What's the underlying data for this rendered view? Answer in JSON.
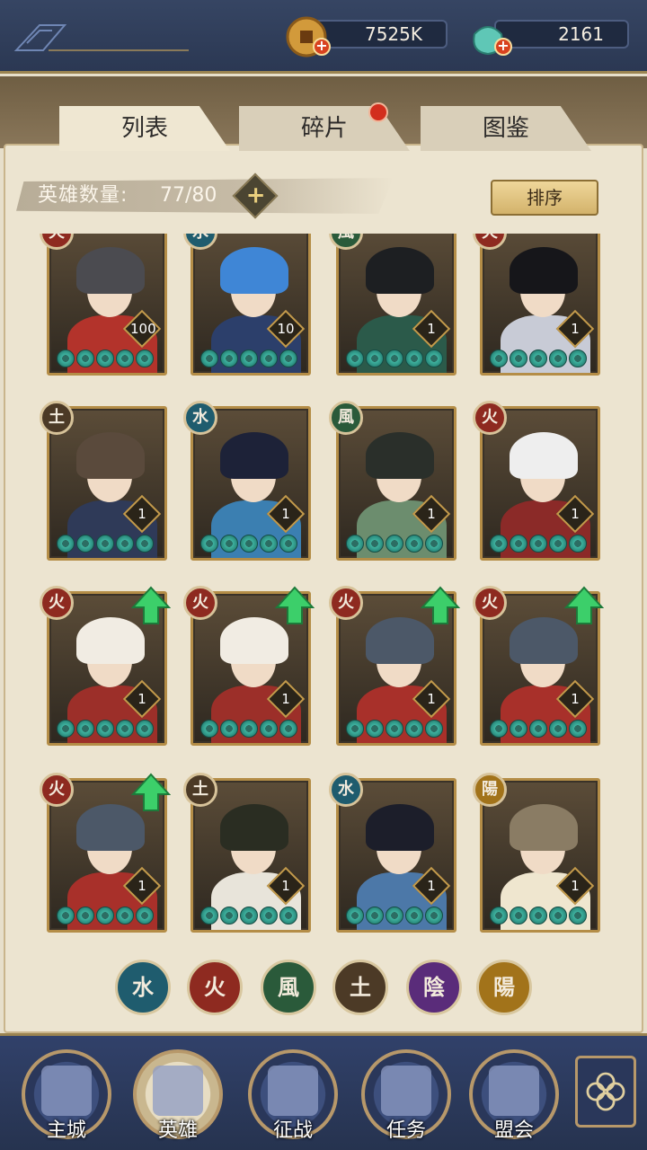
{
  "resources": {
    "copper": {
      "value": "7525K",
      "icon": "copper-coin-icon"
    },
    "jade": {
      "value": "2161",
      "icon": "jade-pouch-icon"
    }
  },
  "tabs": [
    {
      "label": "列表",
      "active": true
    },
    {
      "label": "碎片",
      "active": false,
      "notification": true
    },
    {
      "label": "图鉴",
      "active": false
    }
  ],
  "hero_count": {
    "label": "英雄数量:",
    "value": "77/80"
  },
  "sort_label": "排序",
  "heroes": [
    {
      "element": "火",
      "level": "100",
      "stars": 5,
      "upgrade": false,
      "colors": {
        "hair": "#4b4b50",
        "body": "#b3332b"
      }
    },
    {
      "element": "水",
      "level": "10",
      "stars": 5,
      "upgrade": false,
      "colors": {
        "hair": "#3f86d6",
        "body": "#2c3f6b"
      }
    },
    {
      "element": "風",
      "level": "1",
      "stars": 5,
      "upgrade": false,
      "colors": {
        "hair": "#1d1f22",
        "body": "#2b5a4a"
      }
    },
    {
      "element": "火",
      "level": "1",
      "stars": 5,
      "upgrade": false,
      "colors": {
        "hair": "#16161a",
        "body": "#c8cbd6"
      }
    },
    {
      "element": "土",
      "level": "1",
      "stars": 5,
      "upgrade": false,
      "colors": {
        "hair": "#5a4a3c",
        "body": "#2f3a58"
      }
    },
    {
      "element": "水",
      "level": "1",
      "stars": 5,
      "upgrade": false,
      "colors": {
        "hair": "#1d2238",
        "body": "#3b7fb1"
      }
    },
    {
      "element": "風",
      "level": "1",
      "stars": 5,
      "upgrade": false,
      "colors": {
        "hair": "#2a2f2a",
        "body": "#6c8d6e"
      }
    },
    {
      "element": "火",
      "level": "1",
      "stars": 5,
      "upgrade": false,
      "colors": {
        "hair": "#eeeeee",
        "body": "#8b2a28"
      }
    },
    {
      "element": "火",
      "level": "1",
      "stars": 5,
      "upgrade": true,
      "colors": {
        "hair": "#f1ece3",
        "body": "#9c2f29"
      }
    },
    {
      "element": "火",
      "level": "1",
      "stars": 5,
      "upgrade": true,
      "colors": {
        "hair": "#f1ece3",
        "body": "#9c2f29"
      }
    },
    {
      "element": "火",
      "level": "1",
      "stars": 5,
      "upgrade": true,
      "colors": {
        "hair": "#4c5868",
        "body": "#a8302a"
      }
    },
    {
      "element": "火",
      "level": "1",
      "stars": 5,
      "upgrade": true,
      "colors": {
        "hair": "#4c5868",
        "body": "#a8302a"
      }
    },
    {
      "element": "火",
      "level": "1",
      "stars": 5,
      "upgrade": true,
      "colors": {
        "hair": "#4c5868",
        "body": "#a8302a"
      }
    },
    {
      "element": "土",
      "level": "1",
      "stars": 5,
      "upgrade": false,
      "colors": {
        "hair": "#2a2d22",
        "body": "#e8e4da"
      }
    },
    {
      "element": "水",
      "level": "1",
      "stars": 5,
      "upgrade": false,
      "colors": {
        "hair": "#1c1e2a",
        "body": "#4c78a8"
      }
    },
    {
      "element": "陽",
      "level": "1",
      "stars": 5,
      "upgrade": false,
      "colors": {
        "hair": "#8a7c64",
        "body": "#efe6cf"
      }
    }
  ],
  "element_colors": {
    "火": "#8e2a20",
    "水": "#1f5c6e",
    "風": "#2a5a3a",
    "土": "#4c3a26",
    "陰": "#5a2c7a",
    "陽": "#a2731a"
  },
  "element_filters": [
    "水",
    "火",
    "風",
    "土",
    "陰",
    "陽"
  ],
  "nav": [
    {
      "label": "主城",
      "icon": "city-gate-icon",
      "active": false
    },
    {
      "label": "英雄",
      "icon": "hero-portrait-icon",
      "active": true
    },
    {
      "label": "征战",
      "icon": "war-horn-icon",
      "active": false
    },
    {
      "label": "任务",
      "icon": "scroll-banner-icon",
      "active": false
    },
    {
      "label": "盟会",
      "icon": "alliance-pavilion-icon",
      "active": false
    }
  ],
  "menu_icon": "flower-menu-icon"
}
